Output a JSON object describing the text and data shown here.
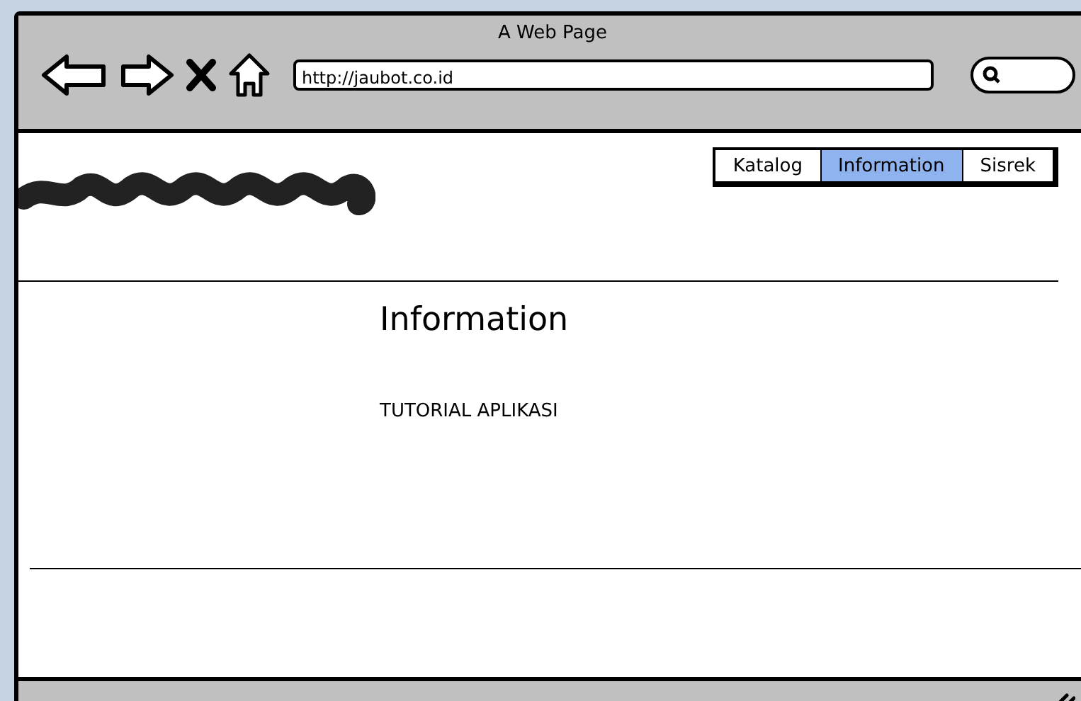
{
  "window": {
    "title": "A Web Page"
  },
  "address_bar": {
    "value": "http://jaubot.co.id"
  },
  "nav_tabs": [
    {
      "label": "Katalog",
      "selected": false
    },
    {
      "label": "Information",
      "selected": true
    },
    {
      "label": "Sisrek",
      "selected": false
    }
  ],
  "content": {
    "heading": "Information",
    "text": "TUTORIAL APLIKASI"
  }
}
